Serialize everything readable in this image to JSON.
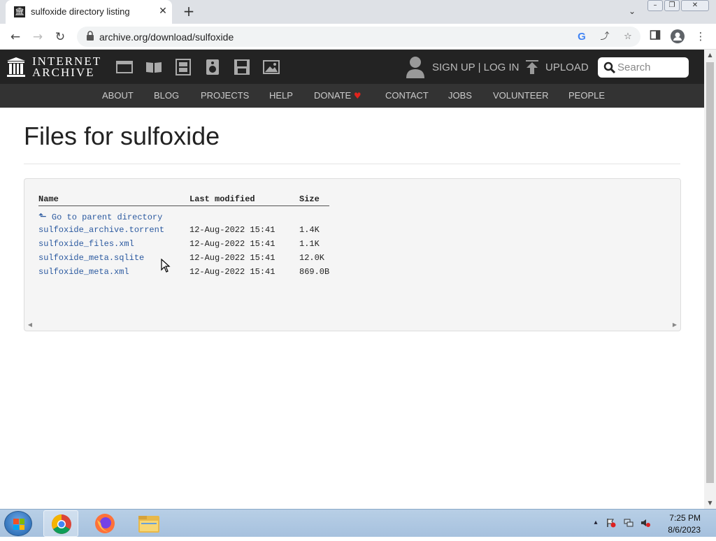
{
  "browser": {
    "tab_title": "sulfoxide directory listing",
    "tab_favicon_icon": "internet-archive-icon",
    "url": "archive.org/download/sulfoxide"
  },
  "ia_header": {
    "logo_line1": "INTERNET",
    "logo_line2": "ARCHIVE",
    "signup_login": "SIGN UP | LOG IN",
    "upload": "UPLOAD",
    "search_placeholder": "Search",
    "media_icons": [
      "web-icon",
      "texts-icon",
      "video-icon",
      "audio-icon",
      "software-icon",
      "images-icon"
    ],
    "nav": [
      "ABOUT",
      "BLOG",
      "PROJECTS",
      "HELP",
      "DONATE",
      "CONTACT",
      "JOBS",
      "VOLUNTEER",
      "PEOPLE"
    ]
  },
  "page": {
    "title": "Files for sulfoxide",
    "columns": [
      "Name",
      "Last modified",
      "Size"
    ],
    "parent_link": "Go to parent directory",
    "files": [
      {
        "name": "sulfoxide_archive.torrent",
        "modified": "12-Aug-2022 15:41",
        "size": "1.4K"
      },
      {
        "name": "sulfoxide_files.xml",
        "modified": "12-Aug-2022 15:41",
        "size": "1.1K"
      },
      {
        "name": "sulfoxide_meta.sqlite",
        "modified": "12-Aug-2022 15:41",
        "size": "12.0K"
      },
      {
        "name": "sulfoxide_meta.xml",
        "modified": "12-Aug-2022 15:41",
        "size": "869.0B"
      }
    ]
  },
  "taskbar": {
    "time": "7:25 PM",
    "date": "8/6/2023",
    "apps": [
      "chrome-icon",
      "firefox-icon",
      "file-explorer-icon"
    ]
  },
  "colors": {
    "ia_dark": "#232323",
    "ia_nav": "#333333",
    "link": "#2c5aa0",
    "donate_heart": "#e0231c"
  }
}
